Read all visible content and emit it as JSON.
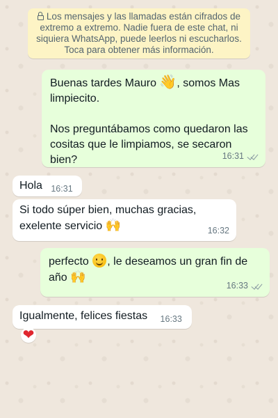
{
  "encryption_notice": {
    "text": "Los mensajes y las llamadas están cifrados de extremo a extremo. Nadie fuera de este chat, ni siquiera WhatsApp, puede leerlos ni escucharlos. Toca para obtener más información.",
    "icon": "lock-icon"
  },
  "messages": [
    {
      "direction": "outgoing",
      "paragraph1_part1": "Buenas tardes Mauro ",
      "paragraph1_emoji": "👋",
      "paragraph1_part2": ", somos Mas limpiecito.",
      "paragraph2": "Nos preguntábamos como quedaron las cositas que le limpiamos, se secaron bien?",
      "time": "16:31",
      "status": "read"
    },
    {
      "direction": "incoming",
      "text": "Hola",
      "time": "16:31"
    },
    {
      "direction": "incoming",
      "text": "Si todo súper bien, muchas gracias, exelente servicio ",
      "emoji": "🙌",
      "time": "16:32"
    },
    {
      "direction": "outgoing",
      "text_part1": "perfecto ",
      "text_part2": ", le deseamos un gran fin de año ",
      "emoji": "🙌",
      "time": "16:33",
      "status": "read"
    },
    {
      "direction": "incoming",
      "text": "Igualmente, felices fiestas",
      "time": "16:33",
      "reaction_emoji": "❤"
    }
  ],
  "colors": {
    "wallpaper": "#efe7dd",
    "outgoing_bubble": "#e7ffdb",
    "incoming_bubble": "#ffffff",
    "notice_bg": "#fdf4c5",
    "meta_text": "#667781"
  }
}
